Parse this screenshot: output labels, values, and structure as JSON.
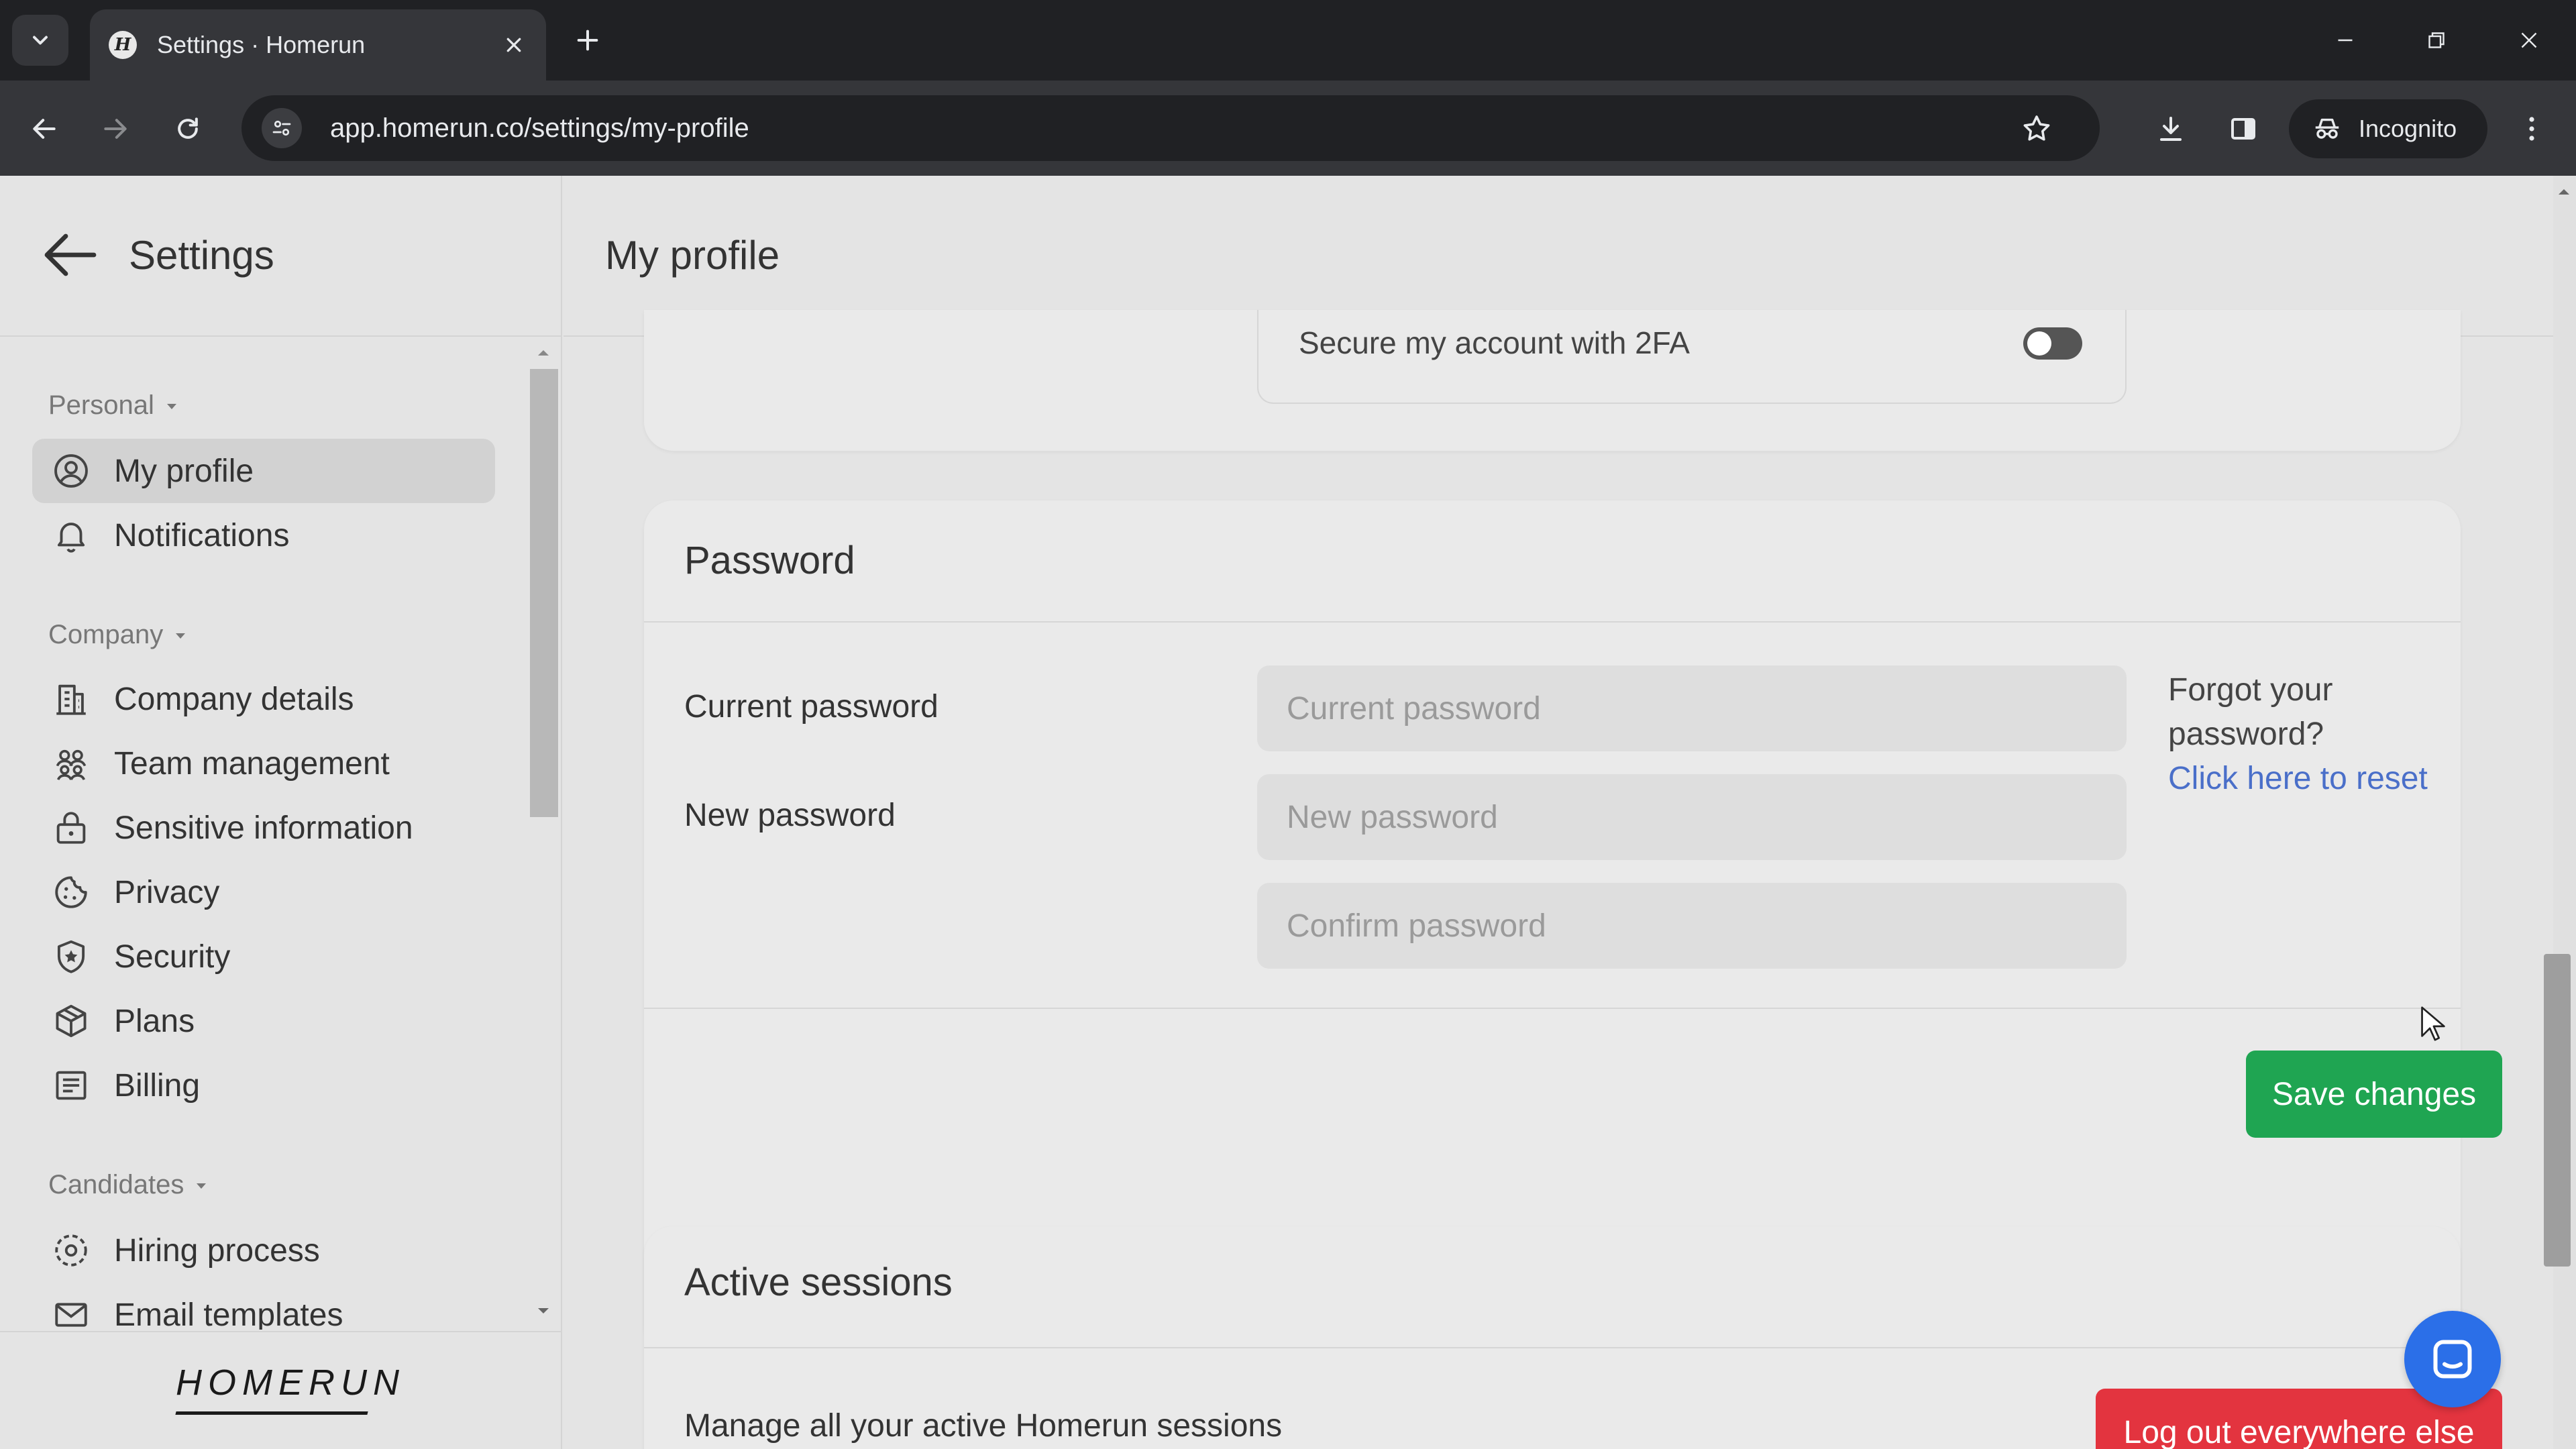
{
  "browser": {
    "tab_title": "Settings · Homerun",
    "favicon_letter": "H",
    "url": "app.homerun.co/settings/my-profile",
    "profile_label": "Incognito"
  },
  "sidebar": {
    "title": "Settings",
    "groups": {
      "personal": "Personal",
      "company": "Company",
      "candidates": "Candidates"
    },
    "items": [
      {
        "label": "My profile",
        "icon": "user-circle-icon",
        "active": true
      },
      {
        "label": "Notifications",
        "icon": "bell-icon"
      },
      {
        "label": "Company details",
        "icon": "building-icon"
      },
      {
        "label": "Team management",
        "icon": "team-icon"
      },
      {
        "label": "Sensitive information",
        "icon": "lock-icon"
      },
      {
        "label": "Privacy",
        "icon": "cookie-icon"
      },
      {
        "label": "Security",
        "icon": "shield-star-icon"
      },
      {
        "label": "Plans",
        "icon": "package-icon"
      },
      {
        "label": "Billing",
        "icon": "receipt-icon"
      },
      {
        "label": "Hiring process",
        "icon": "hiring-process-icon"
      },
      {
        "label": "Email templates",
        "icon": "envelope-icon"
      }
    ],
    "logo": "HOMERUN"
  },
  "main": {
    "title": "My profile",
    "twofa": {
      "label": "Secure my account with 2FA",
      "enabled": false
    },
    "password": {
      "title": "Password",
      "current_label": "Current password",
      "current_placeholder": "Current password",
      "new_label": "New password",
      "new_placeholder": "New password",
      "confirm_placeholder": "Confirm password",
      "forgot_text": "Forgot your password?",
      "reset_link": "Click here to reset",
      "save_label": "Save changes"
    },
    "sessions": {
      "title": "Active sessions",
      "description": "Manage all your active Homerun sessions",
      "logout_label": "Log out everywhere else"
    }
  },
  "colors": {
    "save_button": "#1fa552",
    "logout_button": "#e3343f",
    "link": "#4a6fc9",
    "chat_bubble": "#2b6fe8"
  }
}
